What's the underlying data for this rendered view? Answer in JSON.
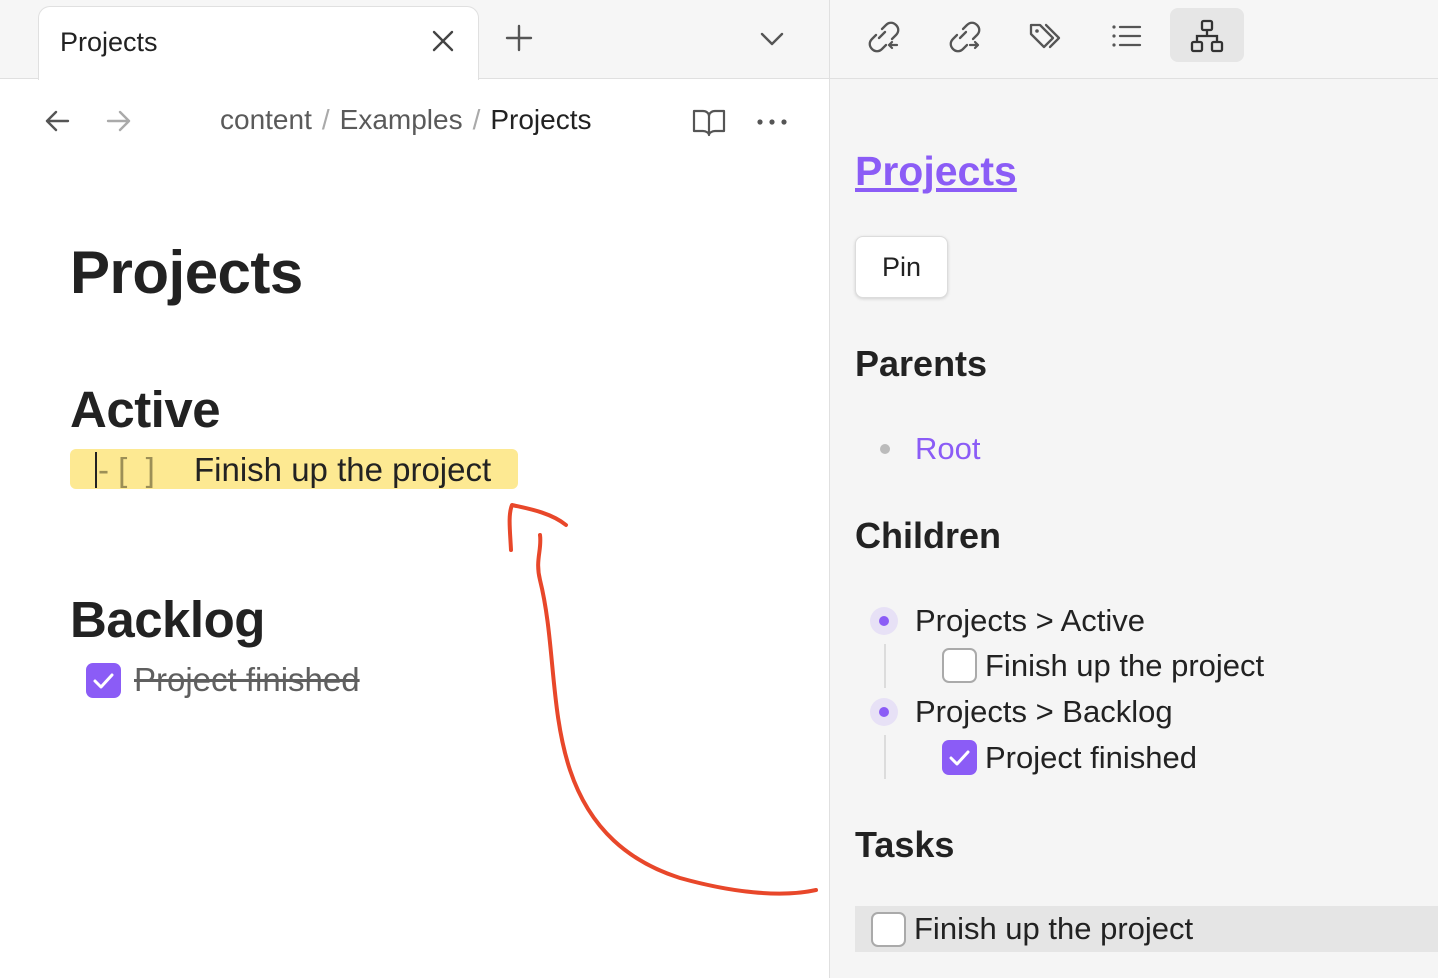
{
  "tab": {
    "title": "Projects"
  },
  "breadcrumb": {
    "items": [
      "content",
      "Examples"
    ],
    "current": "Projects",
    "separator": "/"
  },
  "document": {
    "title": "Projects",
    "sections": [
      {
        "heading": "Active",
        "task": {
          "markdown": "- [  ]",
          "text": "Finish up the project",
          "checked": false,
          "highlighted": true
        }
      },
      {
        "heading": "Backlog",
        "task": {
          "text": "Project finished",
          "checked": true
        }
      }
    ]
  },
  "sidebar": {
    "toolbar_icons": [
      "backlinks-icon",
      "outgoing-links-icon",
      "tags-icon",
      "outline-icon",
      "hierarchy-icon"
    ],
    "active_tool": "hierarchy-icon",
    "title": "Projects",
    "pin_label": "Pin",
    "parents_heading": "Parents",
    "parents": [
      "Root"
    ],
    "children_heading": "Children",
    "children": [
      {
        "label": "Projects > Active",
        "task": "Finish up the project",
        "checked": false
      },
      {
        "label": "Projects > Backlog",
        "task": "Project finished",
        "checked": true
      }
    ],
    "tasks_heading": "Tasks",
    "tasks": [
      {
        "text": "Finish up the project",
        "checked": false
      }
    ]
  },
  "colors": {
    "accent": "#8b5cf6",
    "highlight": "#fde992",
    "annotation": "#e8472a"
  }
}
